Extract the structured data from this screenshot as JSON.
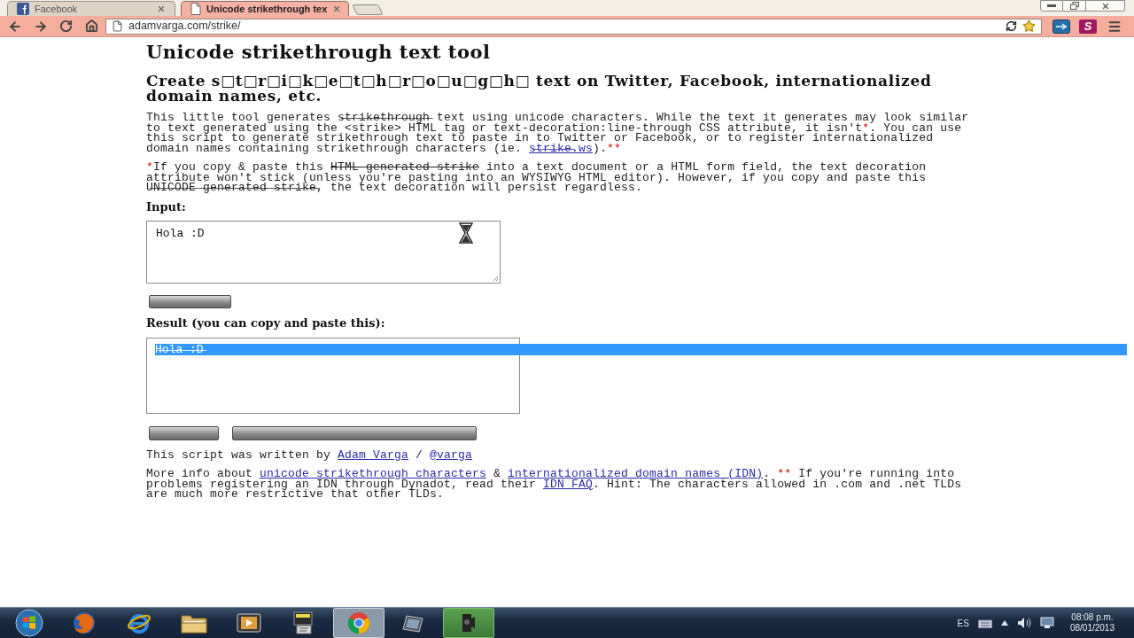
{
  "browser": {
    "tabs": [
      {
        "label": "Facebook",
        "selected": false,
        "kind": "facebook"
      },
      {
        "label": "Unicode strikethrough tex",
        "selected": true,
        "kind": "page"
      }
    ],
    "address": "adamvarga.com/strike/",
    "extension_label": "S"
  },
  "page": {
    "title": "Unicode strikethrough text tool",
    "subtitle": "Create s□t□r□i□k□e□t□h□r□o□u□g□h□ text on Twitter, Facebook, internationalized domain names, etc.",
    "intro": [
      [
        {
          "kind": "plain",
          "text": "This little tool generates s̶t̶r̶i̶k̶e̶t̶h̶r̶o̶u̶g̶h̶ text using unicode characters. While the text it generates may look similar to text generated using the <strike> HTML tag or text-decoration:line-through CSS attribute, it isn't"
        },
        {
          "kind": "note",
          "text": "*"
        },
        {
          "kind": "plain",
          "text": ". You can use this script to generate strikethrough text to paste in to Twitter or Facebook, or to register internationalized domain names containing strikethrough characters (ie. "
        },
        {
          "kind": "link",
          "text": "s̶t̶r̶i̶k̶e̶.ws"
        },
        {
          "kind": "plain",
          "text": ")."
        },
        {
          "kind": "note",
          "text": "**"
        }
      ],
      [
        {
          "kind": "note",
          "text": "*"
        },
        {
          "kind": "plain",
          "text": "If you copy & paste this "
        },
        {
          "kind": "strike",
          "text": "HTML generated strike"
        },
        {
          "kind": "plain",
          "text": " into a text document or a HTML form field, the text decoration attribute won't stick (unless you're pasting into an WYSIWYG HTML editor). However, if you copy and paste this U̶N̶I̶C̶O̶D̶E̶ ̶g̶e̶n̶e̶r̶a̶t̶e̶d̶ ̶s̶t̶r̶i̶k̶e̶, the text decoration will persist regardless."
        }
      ]
    ],
    "input": {
      "label": "Input:",
      "value": "Hola :D"
    },
    "result": {
      "label": "Result (you can copy and paste this):",
      "value": "H̶o̶l̶a̶ ̶:̶D̶",
      "selected": true
    },
    "credit": [
      {
        "kind": "plain",
        "text": "This script was written by "
      },
      {
        "kind": "link",
        "text": "Adam Varga"
      },
      {
        "kind": "plain",
        "text": " / "
      },
      {
        "kind": "link",
        "text": "@varga"
      }
    ],
    "more_info": [
      {
        "kind": "plain",
        "text": "More info about "
      },
      {
        "kind": "link",
        "text": "unicode strikethrough characters"
      },
      {
        "kind": "plain",
        "text": " & "
      },
      {
        "kind": "link",
        "text": "internationalized domain names (IDN)"
      },
      {
        "kind": "plain",
        "text": ". "
      },
      {
        "kind": "note",
        "text": "**"
      },
      {
        "kind": "plain",
        "text": " If you're running into problems registering an IDN through Dynadot, read their "
      },
      {
        "kind": "link",
        "text": "IDN FAQ"
      },
      {
        "kind": "plain",
        "text": ". Hint: The characters allowed in .com and .net TLDs are much more restrictive that other TLDs."
      }
    ]
  },
  "taskbar": {
    "apps": [
      {
        "kind": "start",
        "selected": false,
        "hover": false
      },
      {
        "kind": "fox",
        "selected": false,
        "hover": false
      },
      {
        "kind": "ie",
        "selected": false,
        "hover": false
      },
      {
        "kind": "folder",
        "selected": false,
        "hover": false
      },
      {
        "kind": "media",
        "selected": false,
        "hover": false
      },
      {
        "kind": "notes",
        "selected": false,
        "hover": false
      },
      {
        "kind": "chrome",
        "selected": true,
        "hover": false
      },
      {
        "kind": "tablet",
        "selected": false,
        "hover": false
      },
      {
        "kind": "camera",
        "selected": false,
        "hover": true
      }
    ],
    "language": "ES",
    "time": "08:08 p.m.",
    "date": "08/01/2013"
  }
}
